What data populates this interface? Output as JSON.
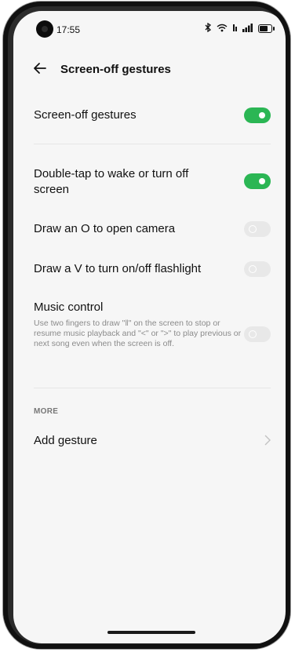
{
  "status": {
    "time": "17:55",
    "icons": [
      "bluetooth-icon",
      "wifi-icon",
      "signal-icon",
      "battery-icon"
    ]
  },
  "header": {
    "title": "Screen-off gestures"
  },
  "settings": [
    {
      "label": "Screen-off gestures",
      "enabled": true
    },
    {
      "label": "Double-tap to wake or turn off screen",
      "enabled": true
    },
    {
      "label": "Draw an O to open camera",
      "enabled": false
    },
    {
      "label": "Draw a V to turn on/off flashlight",
      "enabled": false
    },
    {
      "label": "Music control",
      "description": "Use two fingers to draw \"‖\" on the screen to stop or resume music playback and \"<\" or \">\" to play previous or next song even when the screen is off.",
      "enabled": false
    }
  ],
  "more": {
    "section_label": "MORE",
    "add_gesture_label": "Add gesture"
  },
  "colors": {
    "accent": "#2bb654",
    "toggle_off": "#e8e8e8",
    "background": "#f6f6f6"
  }
}
